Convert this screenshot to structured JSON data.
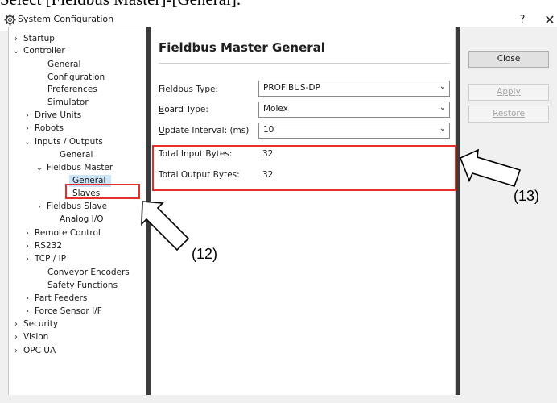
{
  "document": {
    "caption": "Select [Fieldbus Master]-[General]."
  },
  "window": {
    "title": "System Configuration",
    "help_label": "?",
    "close_label": "✕"
  },
  "tree": {
    "items": [
      {
        "label": "Startup",
        "chevron": "›"
      },
      {
        "label": "Controller",
        "chevron": "⌄"
      },
      {
        "label": "General",
        "chevron": ""
      },
      {
        "label": "Configuration",
        "chevron": ""
      },
      {
        "label": "Preferences",
        "chevron": ""
      },
      {
        "label": "Simulator",
        "chevron": ""
      },
      {
        "label": "Drive Units",
        "chevron": "›"
      },
      {
        "label": "Robots",
        "chevron": "›"
      },
      {
        "label": "Inputs / Outputs",
        "chevron": "⌄"
      },
      {
        "label": "General",
        "chevron": ""
      },
      {
        "label": "Fieldbus Master",
        "chevron": "⌄"
      },
      {
        "label": "General",
        "chevron": ""
      },
      {
        "label": "Slaves",
        "chevron": ""
      },
      {
        "label": "Fieldbus Slave",
        "chevron": "›"
      },
      {
        "label": "Analog I/O",
        "chevron": ""
      },
      {
        "label": "Remote Control",
        "chevron": "›"
      },
      {
        "label": "RS232",
        "chevron": "›"
      },
      {
        "label": "TCP / IP",
        "chevron": "›"
      },
      {
        "label": "Conveyor Encoders",
        "chevron": ""
      },
      {
        "label": "Safety Functions",
        "chevron": ""
      },
      {
        "label": "Part Feeders",
        "chevron": "›"
      },
      {
        "label": "Force Sensor I/F",
        "chevron": "›"
      },
      {
        "label": "Security",
        "chevron": "›"
      },
      {
        "label": "Vision",
        "chevron": "›"
      },
      {
        "label": "OPC UA",
        "chevron": "›"
      }
    ]
  },
  "content": {
    "heading": "Fieldbus Master General",
    "fieldbus_type": {
      "label_key": "F",
      "label_rest": "ieldbus Type:",
      "value": "PROFIBUS-DP"
    },
    "board_type": {
      "label_key": "B",
      "label_rest": "oard Type:",
      "value": "Molex"
    },
    "update_interval": {
      "label_key": "U",
      "label_rest": "pdate Interval: (ms)",
      "value": "10"
    },
    "total_input": {
      "label": "Total Input Bytes:",
      "value": "32"
    },
    "total_output": {
      "label": "Total Output Bytes:",
      "value": "32"
    }
  },
  "buttons": {
    "close": "Close",
    "apply": "Apply",
    "restore": "Restore"
  },
  "annotations": {
    "a12": "(12)",
    "a13": "(13)"
  },
  "colors": {
    "highlight": "#e8302b",
    "selection": "#cce4f7",
    "splitter": "#3b3b3b"
  }
}
